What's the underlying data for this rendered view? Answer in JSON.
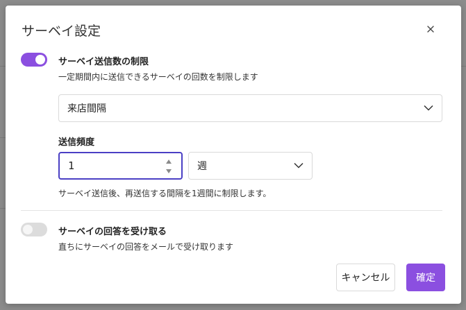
{
  "dialog": {
    "title": "サーベイ設定",
    "close_icon": "close-icon",
    "limit_section": {
      "enabled": true,
      "label": "サーベイ送信数の制限",
      "description": "一定期間内に送信できるサーベイの回数を制限します",
      "basis_select": {
        "value": "来店間隔"
      },
      "frequency_label": "送信頻度",
      "frequency_value": "1",
      "period_select": {
        "value": "週"
      },
      "summary": "サーベイ送信後、再送信する間隔を1週間に制限します。"
    },
    "reply_section": {
      "enabled": false,
      "label": "サーベイの回答を受け取る",
      "description": "直ちにサーベイの回答をメールで受け取ります"
    },
    "buttons": {
      "cancel": "キャンセル",
      "confirm": "確定"
    },
    "colors": {
      "accent": "#8b4fe0",
      "focus_border": "#4a3fc4"
    }
  }
}
